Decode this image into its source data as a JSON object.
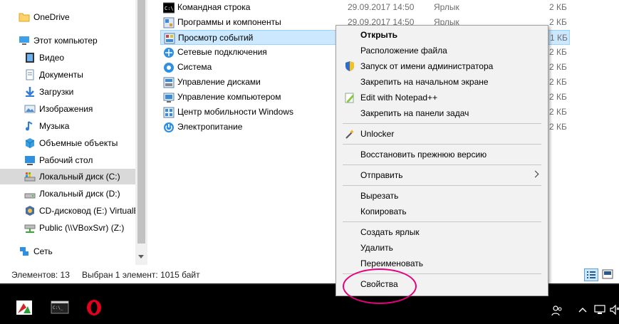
{
  "nav": {
    "items": [
      {
        "label": "OneDrive",
        "icon": "folder-icon"
      },
      {
        "label": "Этот компьютер",
        "icon": "computer-icon"
      },
      {
        "label": "Видео",
        "icon": "video-icon"
      },
      {
        "label": "Документы",
        "icon": "documents-icon"
      },
      {
        "label": "Загрузки",
        "icon": "downloads-icon"
      },
      {
        "label": "Изображения",
        "icon": "pictures-icon"
      },
      {
        "label": "Музыка",
        "icon": "music-icon"
      },
      {
        "label": "Объемные объекты",
        "icon": "3d-objects-icon"
      },
      {
        "label": "Рабочий стол",
        "icon": "desktop-icon"
      },
      {
        "label": "Локальный диск (C:)",
        "icon": "system-drive-icon"
      },
      {
        "label": "Локальный диск (D:)",
        "icon": "drive-icon"
      },
      {
        "label": "CD-дисковод (E:) VirtualB",
        "icon": "cd-drive-icon"
      },
      {
        "label": "Public (\\\\VBoxSvr) (Z:)",
        "icon": "network-drive-icon"
      },
      {
        "label": "Сеть",
        "icon": "network-icon"
      }
    ]
  },
  "files": [
    {
      "name": "Командная строка",
      "date": "29.09.2017 14:50",
      "type": "Ярлык",
      "size": "2 КБ",
      "icon": "cmd-icon"
    },
    {
      "name": "Программы и компоненты",
      "date": "29.09.2017 14:50",
      "type": "Ярлык",
      "size": "2 КБ",
      "icon": "programs-icon"
    },
    {
      "name": "Просмотр событий",
      "date": "",
      "type": "",
      "size": "1 КБ",
      "icon": "event-viewer-icon"
    },
    {
      "name": "Сетевые подключения",
      "date": "",
      "type": "",
      "size": "2 КБ",
      "icon": "network-connections-icon"
    },
    {
      "name": "Система",
      "date": "",
      "type": "",
      "size": "2 КБ",
      "icon": "system-icon"
    },
    {
      "name": "Управление дисками",
      "date": "",
      "type": "",
      "size": "2 КБ",
      "icon": "disk-management-icon"
    },
    {
      "name": "Управление компьютером",
      "date": "",
      "type": "",
      "size": "2 КБ",
      "icon": "computer-management-icon"
    },
    {
      "name": "Центр мобильности Windows",
      "date": "",
      "type": "",
      "size": "2 КБ",
      "icon": "mobility-center-icon"
    },
    {
      "name": "Электропитание",
      "date": "",
      "type": "",
      "size": "2 КБ",
      "icon": "power-options-icon"
    }
  ],
  "status": {
    "count": "Элементов: 13",
    "selection": "Выбран 1 элемент: 1015 байт"
  },
  "context_menu": {
    "open": "Открыть",
    "file_location": "Расположение файла",
    "run_as_admin": "Запуск от имени администратора",
    "pin_start": "Закрепить на начальном экране",
    "edit_notepad": "Edit with Notepad++",
    "pin_taskbar": "Закрепить на панели задач",
    "unlocker": "Unlocker",
    "restore_previous": "Восстановить прежнюю версию",
    "send_to": "Отправить",
    "cut": "Вырезать",
    "copy": "Копировать",
    "create_shortcut": "Создать ярлык",
    "delete": "Удалить",
    "rename": "Переименовать",
    "properties": "Свойства"
  },
  "taskbar": {
    "apps": [
      "app-icon",
      "terminal-icon",
      "opera-icon"
    ],
    "tray": [
      "people-icon",
      "chevron-up-icon",
      "network-tray-icon",
      "volume-icon"
    ]
  },
  "colors": {
    "selection_bg": "#cce8ff",
    "highlight_ellipse": "#e6007e",
    "menu_bg": "#f2f2f2",
    "taskbar_bg": "#000000"
  }
}
